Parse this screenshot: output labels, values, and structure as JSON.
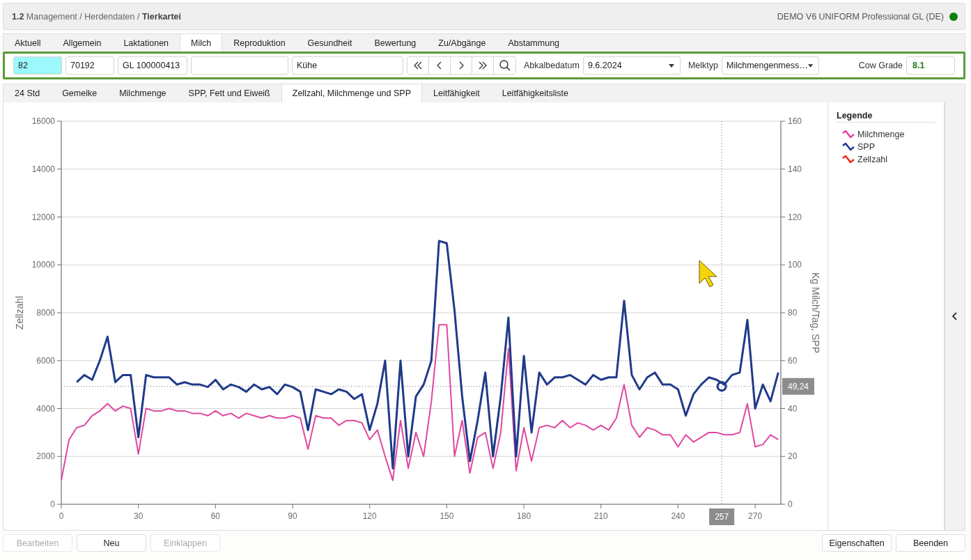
{
  "header": {
    "breadcrumb": "**1.2** Management / Herdendaten / **Tierkartei**",
    "license": "DEMO V6 UNIFORM Professional GL (DE)",
    "online": true
  },
  "tabs": [
    {
      "label": "Aktuell",
      "selected": false
    },
    {
      "label": "Allgemein",
      "selected": false
    },
    {
      "label": "Laktationen",
      "selected": false
    },
    {
      "label": "Milch",
      "selected": true
    },
    {
      "label": "Reproduktion",
      "selected": false
    },
    {
      "label": "Gesundheit",
      "selected": false
    },
    {
      "label": "Bewertung",
      "selected": false
    },
    {
      "label": "Zu/Abgänge",
      "selected": false
    },
    {
      "label": "Abstammung",
      "selected": false
    }
  ],
  "toolbar": {
    "fields": [
      {
        "value": "82",
        "highlighted": true
      },
      {
        "value": "70192",
        "highlighted": false
      },
      {
        "value": "GL 100000413",
        "highlighted": false
      },
      {
        "highlighted": false
      },
      {
        "value": "Kühe",
        "highlighted": false
      }
    ],
    "nav_buttons": [
      {
        "kind": "first"
      },
      {
        "kind": "prev"
      },
      {
        "kind": "next"
      },
      {
        "kind": "last"
      },
      {
        "kind": "search"
      }
    ],
    "calving_date": {
      "label": "Abkalbedatum",
      "value": "9.6.2024"
    },
    "milking_type": {
      "label": "Melktyp",
      "value": "Milchmengenmess…"
    },
    "cow_grade": {
      "label": "Cow Grade",
      "value": "8.1"
    }
  },
  "subtabs": [
    {
      "label": "24 Std",
      "selected": false
    },
    {
      "label": "Gemelke",
      "selected": false
    },
    {
      "label": "Milchmenge",
      "selected": false
    },
    {
      "label": "SPP, Fett und Eiweiß",
      "selected": false
    },
    {
      "label": "Zellzahl, Milchmenge und SPP",
      "selected": true
    },
    {
      "label": "Leitfähigkeit",
      "selected": false
    },
    {
      "label": "Leitfähigkeitsliste",
      "selected": false
    }
  ],
  "chart": {
    "chart_data": {
      "type": "line",
      "ylabel": "Kg Milch/Tag, SPP",
      "xlim": [
        0,
        280
      ],
      "ylim": [
        0,
        160
      ],
      "grid": true,
      "ref_lines": [
        {
          "axis": "x",
          "value": 257,
          "label": "257"
        },
        {
          "axis": "y",
          "value": 49.24,
          "label": "49,24"
        }
      ],
      "xticks": [
        0,
        30,
        60,
        90,
        120,
        150,
        180,
        210,
        240,
        270
      ],
      "yticks": [
        0,
        20,
        40,
        60,
        80,
        100,
        120,
        140,
        160
      ],
      "x": [
        0,
        3,
        6,
        9,
        12,
        15,
        18,
        21,
        24,
        27,
        30,
        33,
        36,
        39,
        42,
        45,
        48,
        51,
        54,
        57,
        60,
        63,
        66,
        69,
        72,
        75,
        78,
        81,
        84,
        87,
        90,
        93,
        96,
        99,
        102,
        105,
        108,
        111,
        114,
        117,
        120,
        123,
        126,
        129,
        132,
        135,
        138,
        141,
        144,
        147,
        150,
        153,
        156,
        159,
        162,
        165,
        168,
        171,
        174,
        177,
        180,
        183,
        186,
        189,
        192,
        195,
        198,
        201,
        204,
        207,
        210,
        213,
        216,
        219,
        222,
        225,
        228,
        231,
        234,
        237,
        240,
        243,
        246,
        249,
        252,
        255,
        258,
        261,
        264,
        267,
        270,
        273,
        276,
        279
      ],
      "series": [
        {
          "name": "Milchmenge",
          "color": "#e0479e",
          "values": [
            10,
            27,
            32,
            33,
            37,
            39,
            42,
            39,
            41,
            40,
            21,
            40,
            39,
            39,
            40,
            39,
            39,
            38,
            38,
            37,
            39,
            37,
            38,
            36,
            38,
            37,
            36,
            37,
            36,
            36,
            37,
            36,
            23,
            37,
            36,
            36,
            33,
            35,
            35,
            34,
            27,
            31,
            20,
            10,
            35,
            15,
            30,
            20,
            43,
            75,
            75,
            20,
            35,
            13,
            28,
            30,
            15,
            30,
            65,
            14,
            32,
            18,
            32,
            33,
            32,
            35,
            32,
            34,
            33,
            31,
            33,
            31,
            36,
            50,
            33,
            28,
            32,
            31,
            29,
            29,
            24,
            29,
            26,
            28,
            30,
            30,
            29,
            29,
            30,
            42,
            24,
            25,
            29,
            27
          ]
        },
        {
          "name": "SPP",
          "color": "#1f3a8a",
          "values": [
            null,
            null,
            51,
            54,
            52,
            60,
            70,
            51,
            54,
            54,
            28,
            54,
            53,
            53,
            53,
            50,
            51,
            50,
            50,
            49,
            52,
            48,
            50,
            49,
            47,
            50,
            48,
            49,
            46,
            50,
            49,
            47,
            31,
            48,
            47,
            46,
            48,
            47,
            44,
            46,
            31,
            42,
            60,
            15,
            60,
            20,
            45,
            50,
            60,
            110,
            109,
            81,
            45,
            18,
            35,
            55,
            20,
            45,
            78,
            20,
            62,
            30,
            55,
            50,
            53,
            53,
            54,
            52,
            50,
            54,
            52,
            53,
            53,
            85,
            54,
            48,
            53,
            55,
            50,
            50,
            48,
            37,
            46,
            50,
            53,
            52,
            50,
            54,
            55,
            77,
            40,
            50,
            43,
            55
          ]
        }
      ]
    },
    "left_axis": {
      "label": "Zellzahl",
      "ticks": [
        "16000",
        "14000",
        "12000",
        "10000",
        "8000",
        "6000",
        "4000",
        "2000",
        "0"
      ]
    },
    "legend_title": "Legende",
    "legend_extra": [
      {
        "name": "Zellzahl",
        "color": "#ee2a24"
      }
    ]
  },
  "buttons_left": [
    {
      "label": "Bearbeiten",
      "disabled": true
    },
    {
      "label": "Neu",
      "disabled": false
    },
    {
      "label": "Einklappen",
      "disabled": true
    }
  ],
  "buttons_right": [
    {
      "label": "Eigenschaften",
      "disabled": false
    },
    {
      "label": "Beenden",
      "disabled": false
    }
  ]
}
